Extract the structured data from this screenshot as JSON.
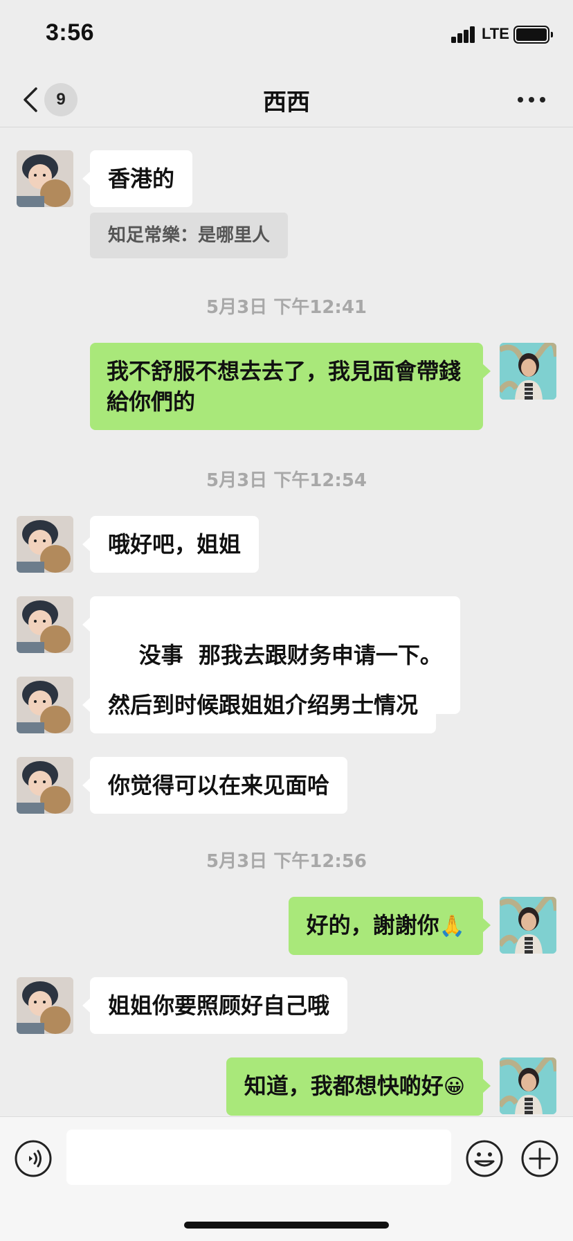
{
  "status_bar": {
    "time": "3:56",
    "network": "LTE"
  },
  "nav": {
    "back_badge": "9",
    "title": "西西"
  },
  "messages": [
    {
      "side": "in",
      "text": "香港的",
      "quote": "知足常樂：是哪里人"
    },
    {
      "timestamp": "5月3日 下午12:41"
    },
    {
      "side": "out",
      "text": "我不舒服不想去去了，我見面會帶錢給你們的"
    },
    {
      "timestamp": "5月3日 下午12:54"
    },
    {
      "side": "in",
      "text": "哦好吧，姐姐"
    },
    {
      "side": "in",
      "text": "没事  那我去跟财务申请一下。"
    },
    {
      "side": "in",
      "text": "然后到时候跟姐姐介绍男士情况"
    },
    {
      "side": "in",
      "text": "你觉得可以在来见面哈"
    },
    {
      "timestamp": "5月3日 下午12:56"
    },
    {
      "side": "out",
      "text": "好的，謝謝你",
      "emoji": "🙏"
    },
    {
      "side": "in",
      "text": "姐姐你要照顾好自己哦"
    },
    {
      "side": "out",
      "text": "知道，我都想快啲好",
      "emoji": "😀"
    }
  ],
  "input_bar": {
    "placeholder": ""
  },
  "icons": {
    "back": "chevron-left-icon",
    "more": "more-dots-icon",
    "voice": "voice-icon",
    "emoji": "emoji-icon",
    "plus": "plus-icon"
  },
  "colors": {
    "background": "#ededed",
    "outgoing_bubble": "#a9e87a",
    "incoming_bubble": "#ffffff",
    "timestamp": "#a8a8a8"
  }
}
